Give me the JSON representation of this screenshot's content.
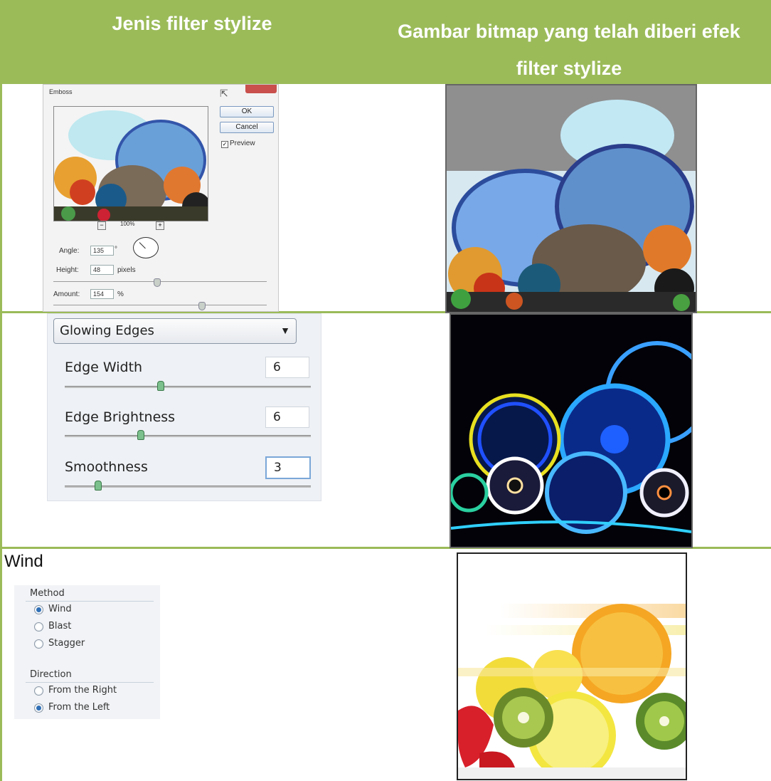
{
  "header": {
    "col1": "Jenis filter stylize",
    "col2_line1": "Gambar bitmap yang telah diberi efek",
    "col2_line2": "filter stylize"
  },
  "emboss": {
    "title": "Emboss",
    "ok": "OK",
    "cancel": "Cancel",
    "preview": "Preview",
    "zoom": "100%",
    "angle_label": "Angle:",
    "angle_value": "135",
    "angle_unit": "°",
    "height_label": "Height:",
    "height_value": "48",
    "height_unit": "pixels",
    "amount_label": "Amount:",
    "amount_value": "154",
    "amount_unit": "%"
  },
  "glowing": {
    "dropdown": "Glowing Edges",
    "edge_width_label": "Edge Width",
    "edge_width_value": "6",
    "edge_brightness_label": "Edge Brightness",
    "edge_brightness_value": "6",
    "smoothness_label": "Smoothness",
    "smoothness_value": "3"
  },
  "wind": {
    "title": "Wind",
    "method_label": "Method",
    "methods": [
      "Wind",
      "Blast",
      "Stagger"
    ],
    "selected_method": "Wind",
    "direction_label": "Direction",
    "directions": [
      "From the Right",
      "From the Left"
    ],
    "selected_direction": "From the Left"
  },
  "colors": {
    "accent": "#9bbb59",
    "header_text": "#ffffff"
  }
}
